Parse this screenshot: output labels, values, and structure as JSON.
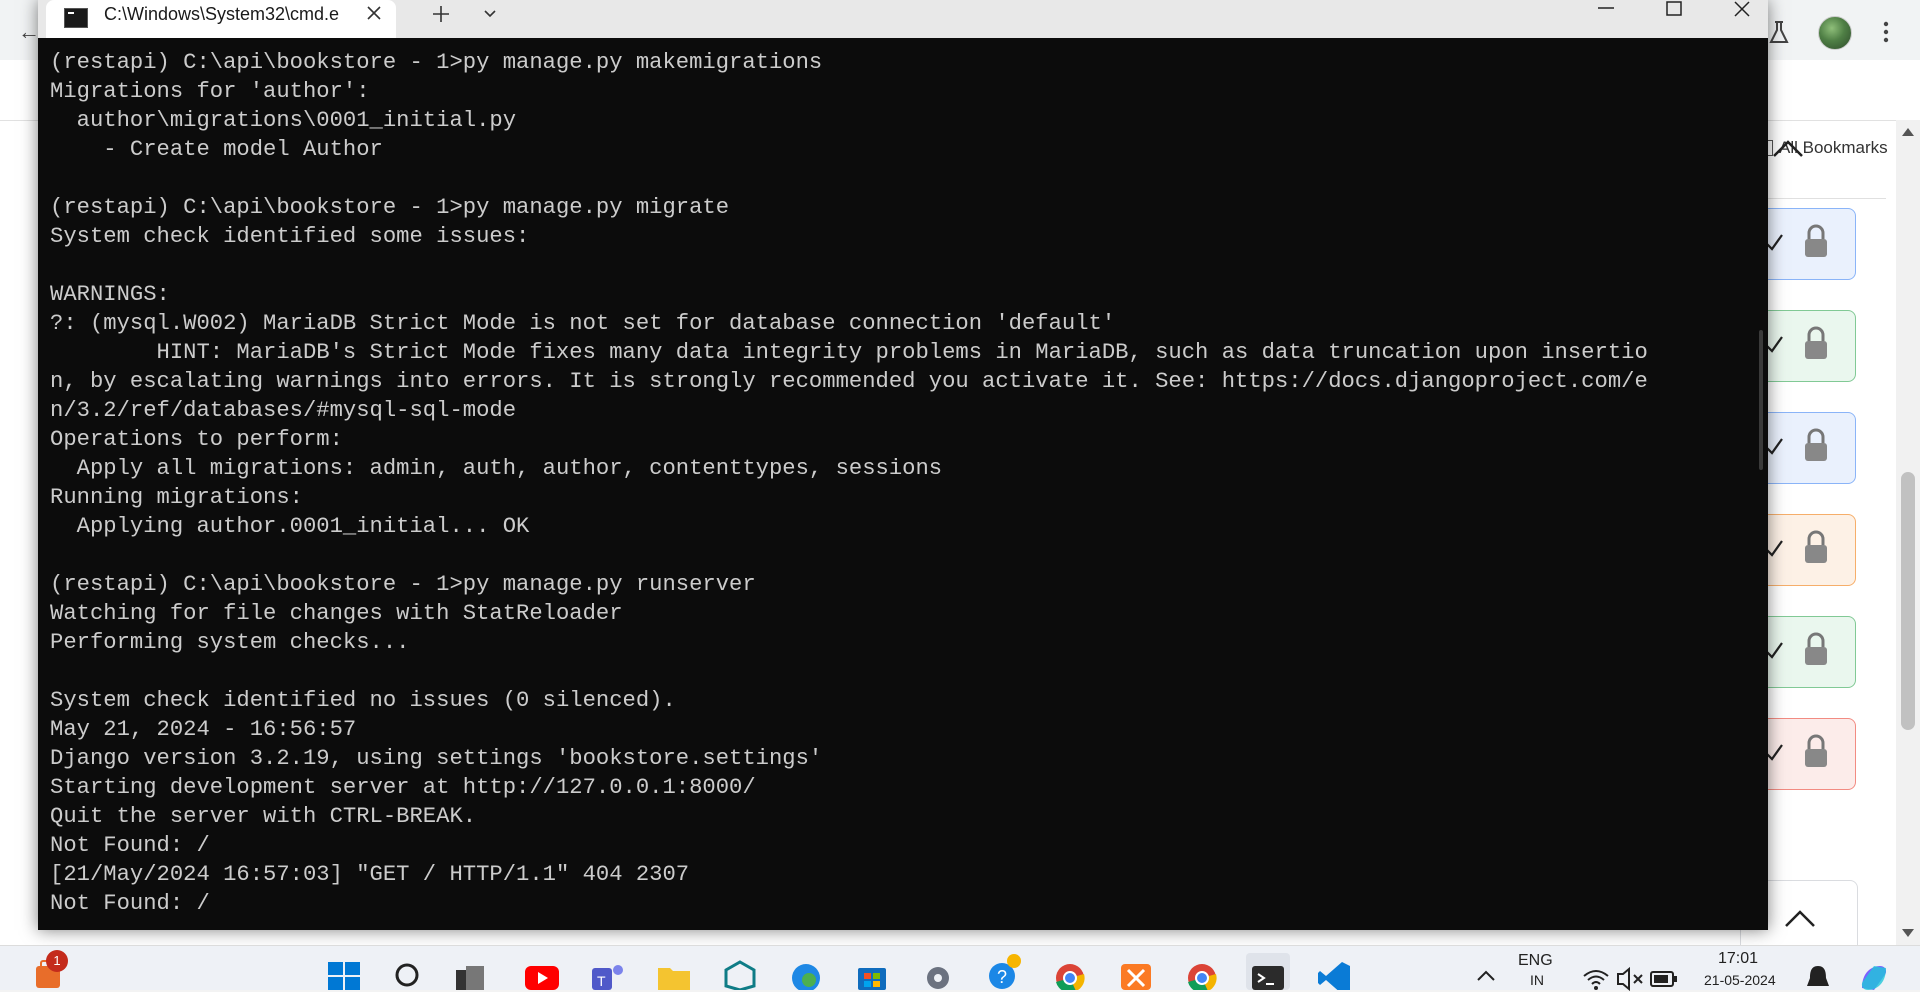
{
  "browser": {
    "all_bookmarks_label": "All Bookmarks"
  },
  "terminal": {
    "tab_title": "C:\\Windows\\System32\\cmd.e",
    "lines": [
      "(restapi) C:\\api\\bookstore - 1>py manage.py makemigrations",
      "Migrations for 'author':",
      "  author\\migrations\\0001_initial.py",
      "    - Create model Author",
      "",
      "(restapi) C:\\api\\bookstore - 1>py manage.py migrate",
      "System check identified some issues:",
      "",
      "WARNINGS:",
      "?: (mysql.W002) MariaDB Strict Mode is not set for database connection 'default'",
      "        HINT: MariaDB's Strict Mode fixes many data integrity problems in MariaDB, such as data truncation upon insertio",
      "n, by escalating warnings into errors. It is strongly recommended you activate it. See: https://docs.djangoproject.com/e",
      "n/3.2/ref/databases/#mysql-sql-mode",
      "Operations to perform:",
      "  Apply all migrations: admin, auth, author, contenttypes, sessions",
      "Running migrations:",
      "  Applying author.0001_initial... OK",
      "",
      "(restapi) C:\\api\\bookstore - 1>py manage.py runserver",
      "Watching for file changes with StatReloader",
      "Performing system checks...",
      "",
      "System check identified no issues (0 silenced).",
      "May 21, 2024 - 16:56:57",
      "Django version 3.2.19, using settings 'bookstore.settings'",
      "Starting development server at http://127.0.0.1:8000/",
      "Quit the server with CTRL-BREAK.",
      "Not Found: /",
      "[21/May/2024 16:57:03] \"GET / HTTP/1.1\" 404 2307",
      "Not Found: /"
    ]
  },
  "cards": [
    {
      "color": "#8ab4f8",
      "bg": "#eaf1fd"
    },
    {
      "color": "#81c995",
      "bg": "#eaf7ee"
    },
    {
      "color": "#8ab4f8",
      "bg": "#eaf1fd"
    },
    {
      "color": "#f6ae6a",
      "bg": "#fdf1e6"
    },
    {
      "color": "#81c995",
      "bg": "#eaf7ee"
    },
    {
      "color": "#f28b82",
      "bg": "#fcecea"
    }
  ],
  "taskbar": {
    "notification_count": "1",
    "language_line1": "ENG",
    "language_line2": "IN",
    "time": "17:01",
    "date": "21-05-2024"
  }
}
